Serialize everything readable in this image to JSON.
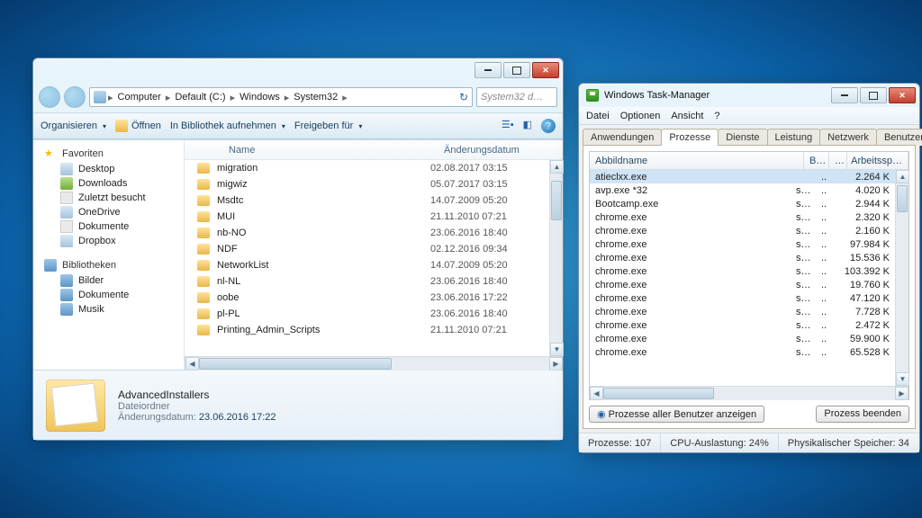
{
  "explorer": {
    "breadcrumb": [
      "Computer",
      "Default (C:)",
      "Windows",
      "System32"
    ],
    "searchPlaceholder": "System32 d…",
    "toolbar": {
      "organize": "Organisieren",
      "open": "Öffnen",
      "include": "In Bibliothek aufnehmen",
      "share": "Freigeben für"
    },
    "nav": {
      "favoritesHeader": "Favoriten",
      "favorites": [
        "Desktop",
        "Downloads",
        "Zuletzt besucht",
        "OneDrive",
        "Dokumente",
        "Dropbox"
      ],
      "librariesHeader": "Bibliotheken",
      "libraries": [
        "Bilder",
        "Dokumente",
        "Musik"
      ]
    },
    "columns": {
      "name": "Name",
      "modified": "Änderungsdatum"
    },
    "files": [
      {
        "name": "migration",
        "date": "02.08.2017 03:15"
      },
      {
        "name": "migwiz",
        "date": "05.07.2017 03:15"
      },
      {
        "name": "Msdtc",
        "date": "14.07.2009 05:20"
      },
      {
        "name": "MUI",
        "date": "21.11.2010 07:21"
      },
      {
        "name": "nb-NO",
        "date": "23.06.2016 18:40"
      },
      {
        "name": "NDF",
        "date": "02.12.2016 09:34"
      },
      {
        "name": "NetworkList",
        "date": "14.07.2009 05:20"
      },
      {
        "name": "nl-NL",
        "date": "23.06.2016 18:40"
      },
      {
        "name": "oobe",
        "date": "23.06.2016 17:22"
      },
      {
        "name": "pl-PL",
        "date": "23.06.2016 18:40"
      },
      {
        "name": "Printing_Admin_Scripts",
        "date": "21.11.2010 07:21"
      }
    ],
    "details": {
      "name": "AdvancedInstallers",
      "type": "Dateiordner",
      "modifiedLabel": "Änderungsdatum:",
      "modified": "23.06.2016 17:22"
    }
  },
  "taskmgr": {
    "title": "Windows Task-Manager",
    "menu": [
      "Datei",
      "Optionen",
      "Ansicht",
      "?"
    ],
    "tabs": [
      "Anwendungen",
      "Prozesse",
      "Dienste",
      "Leistung",
      "Netzwerk",
      "Benutzer"
    ],
    "activeTab": 1,
    "columns": {
      "image": "Abbildname",
      "user": "B…",
      "session": "…",
      "mem": "Arbeitssp…"
    },
    "processes": [
      {
        "name": "atieclxx.exe",
        "user": "",
        "sess": "..",
        "mem": "2.264 K",
        "selected": true
      },
      {
        "name": "avp.exe *32",
        "user": "s…",
        "sess": "..",
        "mem": "4.020 K"
      },
      {
        "name": "Bootcamp.exe",
        "user": "s…",
        "sess": "..",
        "mem": "2.944 K"
      },
      {
        "name": "chrome.exe",
        "user": "s…",
        "sess": "..",
        "mem": "2.320 K"
      },
      {
        "name": "chrome.exe",
        "user": "s…",
        "sess": "..",
        "mem": "2.160 K"
      },
      {
        "name": "chrome.exe",
        "user": "s…",
        "sess": "..",
        "mem": "97.984 K"
      },
      {
        "name": "chrome.exe",
        "user": "s…",
        "sess": "..",
        "mem": "15.536 K"
      },
      {
        "name": "chrome.exe",
        "user": "s…",
        "sess": "..",
        "mem": "103.392 K"
      },
      {
        "name": "chrome.exe",
        "user": "s…",
        "sess": "..",
        "mem": "19.760 K"
      },
      {
        "name": "chrome.exe",
        "user": "s…",
        "sess": "..",
        "mem": "47.120 K"
      },
      {
        "name": "chrome.exe",
        "user": "s…",
        "sess": "..",
        "mem": "7.728 K"
      },
      {
        "name": "chrome.exe",
        "user": "s…",
        "sess": "..",
        "mem": "2.472 K"
      },
      {
        "name": "chrome.exe",
        "user": "s…",
        "sess": "..",
        "mem": "59.900 K"
      },
      {
        "name": "chrome.exe",
        "user": "s…",
        "sess": "..",
        "mem": "65.528 K"
      }
    ],
    "buttons": {
      "allUsers": "Prozesse aller Benutzer anzeigen",
      "end": "Prozess beenden"
    },
    "status": {
      "procs": "Prozesse: 107",
      "cpu": "CPU-Auslastung: 24%",
      "mem": "Physikalischer Speicher: 34"
    }
  }
}
